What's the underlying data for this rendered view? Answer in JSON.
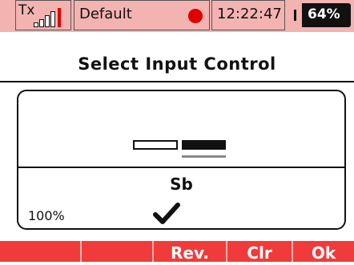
{
  "status_bar": {
    "tx_label": "Tx",
    "profile_name": "Default",
    "time": "12:22:47",
    "battery_percent_text": "64%",
    "battery_level": 0.64,
    "signal_icon": "signal-bars-icon",
    "record_icon": "record-dot-icon",
    "battery_icon": "battery-icon"
  },
  "title": "Select Input Control",
  "panel": {
    "input_name": "Sb",
    "value_text": "100%",
    "check_icon": "checkmark-icon"
  },
  "softkeys": [
    "",
    "",
    "Rev.",
    "Clr",
    "Ok"
  ],
  "colors": {
    "status_bar_bg": "#f3b3b1",
    "softkey_bg": "#f13b3b",
    "record_dot": "#e00000"
  }
}
